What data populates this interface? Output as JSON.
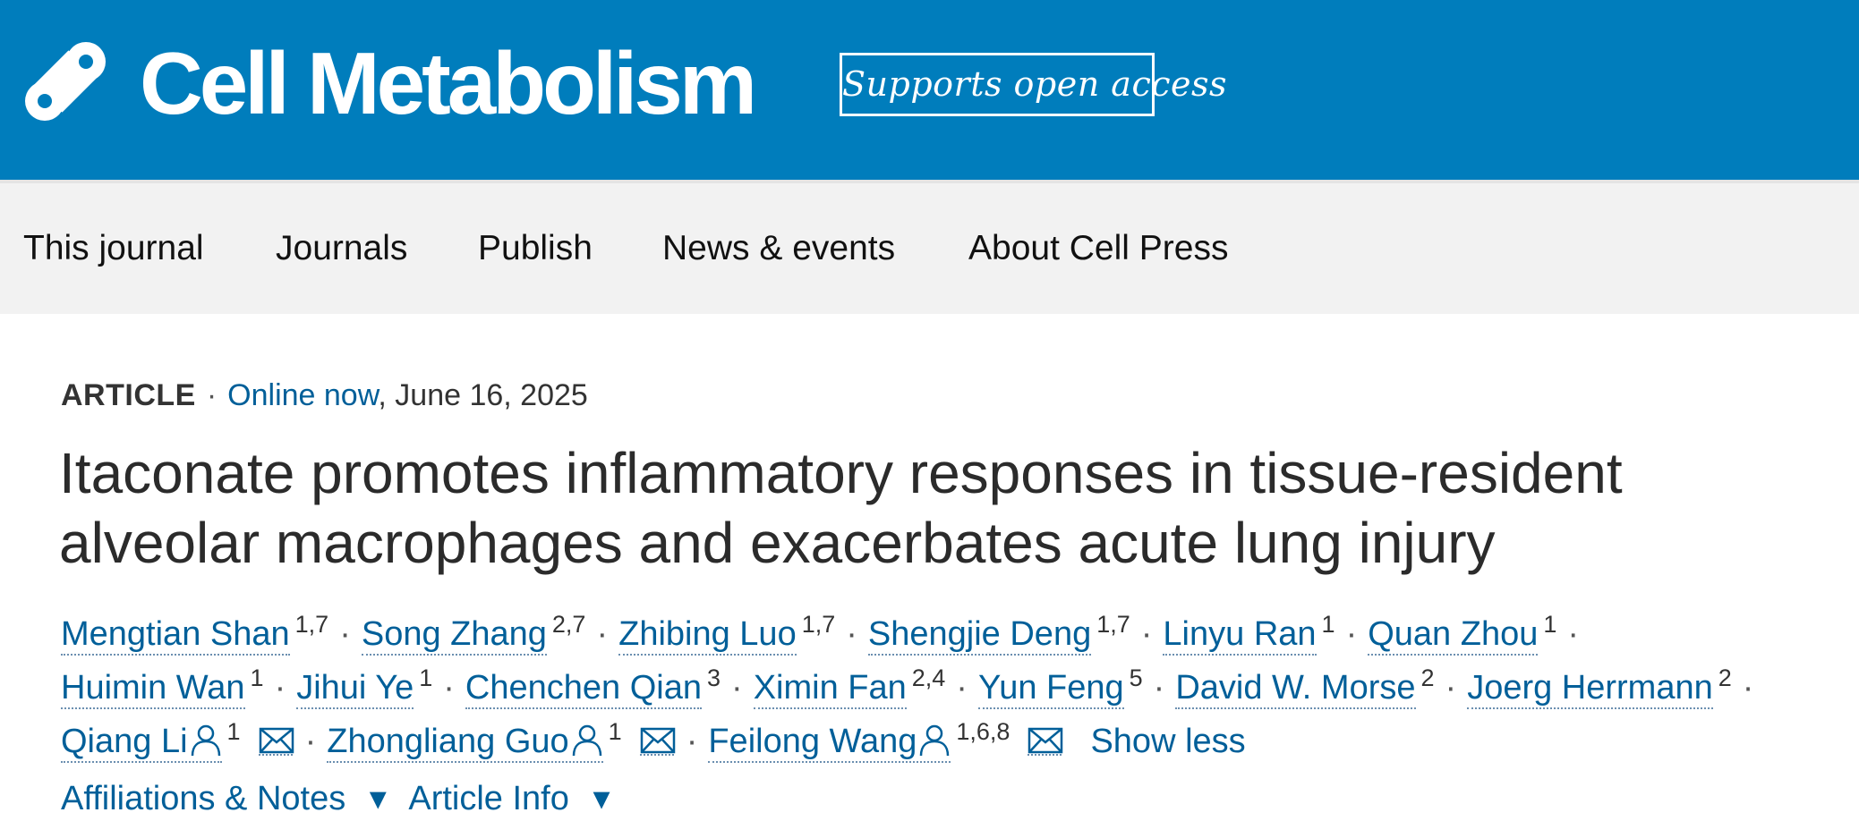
{
  "header": {
    "journal_name": "Cell Metabolism",
    "open_access_badge": "Supports open access",
    "brand_color": "#007dbc"
  },
  "nav": {
    "items": [
      {
        "label": "This journal"
      },
      {
        "label": "Journals"
      },
      {
        "label": "Publish"
      },
      {
        "label": "News & events"
      },
      {
        "label": "About Cell Press"
      }
    ]
  },
  "article": {
    "type": "ARTICLE",
    "status": "Online now",
    "date": ", June 16, 2025",
    "title": "Itaconate promotes inflammatory responses in tissue-resident alveolar macrophages and exacerbates acute lung injury",
    "authors": [
      {
        "name": "Mengtian Shan",
        "aff": "1,7"
      },
      {
        "name": "Song Zhang",
        "aff": "2,7"
      },
      {
        "name": "Zhibing Luo",
        "aff": "1,7"
      },
      {
        "name": "Shengjie Deng",
        "aff": "1,7"
      },
      {
        "name": "Linyu Ran",
        "aff": "1"
      },
      {
        "name": "Quan Zhou",
        "aff": "1"
      },
      {
        "name": "Huimin Wan",
        "aff": "1"
      },
      {
        "name": "Jihui Ye",
        "aff": "1"
      },
      {
        "name": "Chenchen Qian",
        "aff": "3"
      },
      {
        "name": "Ximin Fan",
        "aff": "2,4"
      },
      {
        "name": "Yun Feng",
        "aff": "5"
      },
      {
        "name": "David W. Morse",
        "aff": "2"
      },
      {
        "name": "Joerg Herrmann",
        "aff": "2"
      },
      {
        "name": "Qiang Li",
        "aff": "1"
      },
      {
        "name": "Zhongliang Guo",
        "aff": "1"
      },
      {
        "name": "Feilong Wang",
        "aff": "1,6,8"
      }
    ],
    "separator": "·",
    "show_less": "Show less",
    "bottom_links": [
      "Affiliations & Notes",
      "Article Info"
    ]
  },
  "icons": [
    "cell-press-logo-icon",
    "person-icon",
    "mail-icon",
    "chevron-down-icon"
  ],
  "link_color": "#005f99"
}
